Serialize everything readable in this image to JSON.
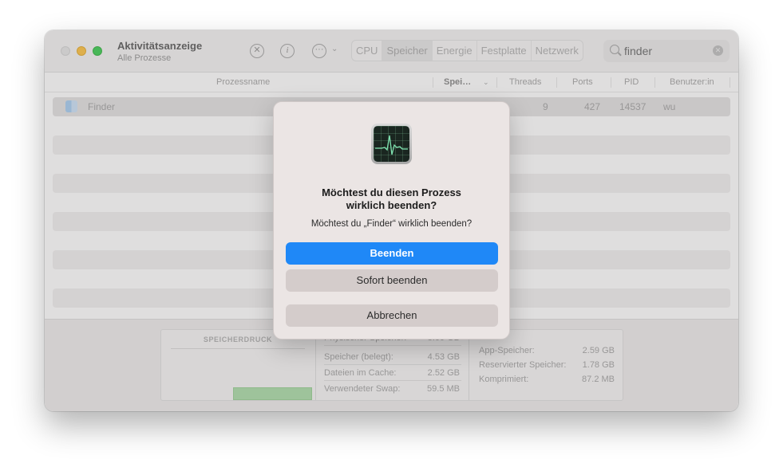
{
  "window": {
    "title": "Aktivitätsanzeige",
    "subtitle": "Alle Prozesse"
  },
  "toolbar": {
    "stop_icon": "x-circle-icon",
    "info_icon": "info-circle-icon",
    "more_icon": "ellipsis-circle-icon",
    "tabs": [
      "CPU",
      "Speicher",
      "Energie",
      "Festplatte",
      "Netzwerk"
    ],
    "active_tab": "Speicher",
    "search": {
      "value": "finder"
    }
  },
  "columns": {
    "name": "Prozessname",
    "memory": "Spei…",
    "threads": "Threads",
    "ports": "Ports",
    "pid": "PID",
    "user": "Benutzer:in"
  },
  "process": {
    "name": "Finder",
    "threads": "9",
    "ports": "427",
    "pid": "14537",
    "user": "wu"
  },
  "memory_panel": {
    "pressure_title": "SPEICHERDRUCK",
    "physical_label": "Physischer Speicher:",
    "physical_value": "8.00 GB",
    "used_label": "Speicher (belegt):",
    "used_value": "4.53 GB",
    "cache_label": "Dateien im Cache:",
    "cache_value": "2.52 GB",
    "swap_label": "Verwendeter Swap:",
    "swap_value": "59.5 MB",
    "app_label": "App-Speicher:",
    "app_value": "2.59 GB",
    "wired_label": "Reservierter Speicher:",
    "wired_value": "1.78 GB",
    "compressed_label": "Komprimiert:",
    "compressed_value": "87.2 MB",
    "pressure_color": "#a3d99f"
  },
  "dialog": {
    "title_line1": "Möchtest du diesen Prozess",
    "title_line2": "wirklich beenden?",
    "message": "Möchtest du „Finder“ wirklich beenden?",
    "quit_label": "Beenden",
    "force_quit_label": "Sofort beenden",
    "cancel_label": "Abbrechen",
    "accent_color": "#1f88f7"
  }
}
